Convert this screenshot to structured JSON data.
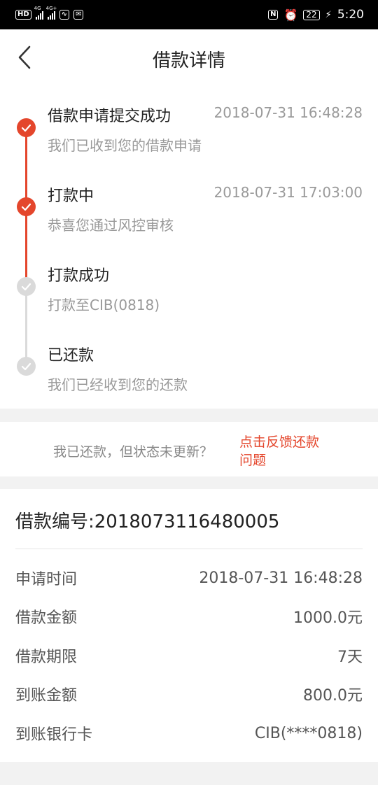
{
  "status_bar": {
    "left_badge": "HD",
    "net1": "4G",
    "net2": "4G+",
    "nfc": "N",
    "battery": "22",
    "time": "5:20"
  },
  "nav": {
    "title": "借款详情"
  },
  "timeline": [
    {
      "title": "借款申请提交成功",
      "time": "2018-07-31 16:48:28",
      "subtitle": "我们已收到您的借款申请",
      "done": true
    },
    {
      "title": "打款中",
      "time": "2018-07-31 17:03:00",
      "subtitle": "恭喜您通过风控审核",
      "done": true
    },
    {
      "title": "打款成功",
      "time": "",
      "subtitle": "打款至CIB(0818)",
      "done": false
    },
    {
      "title": "已还款",
      "time": "",
      "subtitle": "我们已经收到您的还款",
      "done": false
    }
  ],
  "feedback": {
    "text": "我已还款，但状态未更新？",
    "link": "点击反馈还款问题"
  },
  "detail": {
    "loan_no": "借款编号:2018073116480005",
    "rows": [
      {
        "label": "申请时间",
        "value": "2018-07-31 16:48:28"
      },
      {
        "label": "借款金额",
        "value": "1000.0元"
      },
      {
        "label": "借款期限",
        "value": "7天"
      },
      {
        "label": "到账金额",
        "value": "800.0元"
      },
      {
        "label": "到账银行卡",
        "value": "CIB(****0818)"
      }
    ]
  },
  "colors": {
    "accent": "#e4462c",
    "pending": "#dadada",
    "muted_text": "#999999"
  }
}
